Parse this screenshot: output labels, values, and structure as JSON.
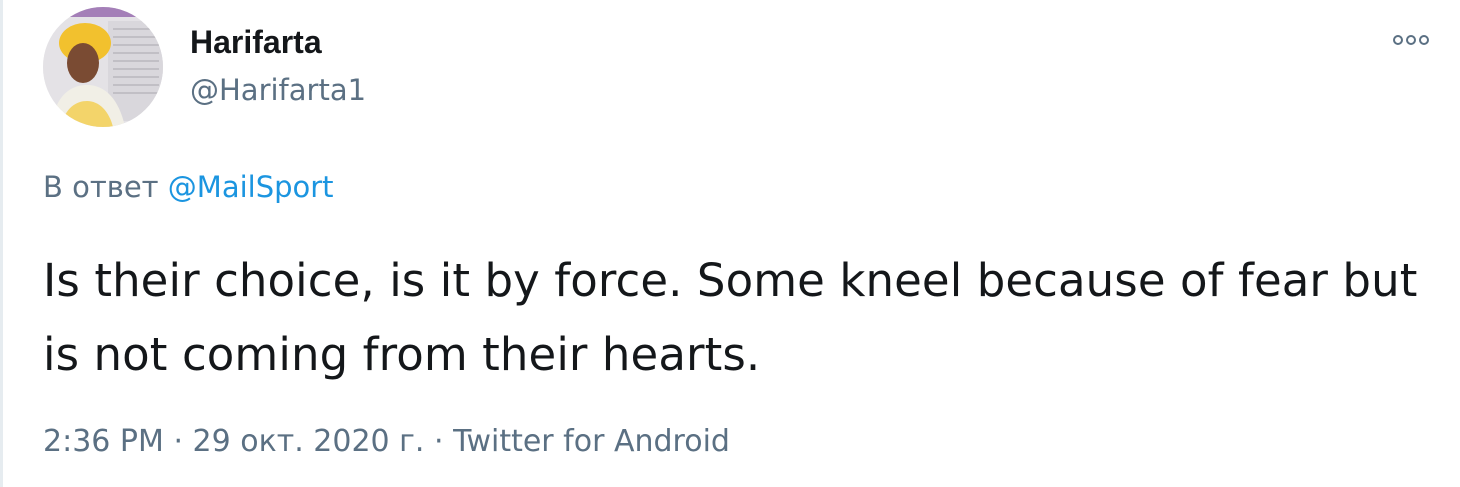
{
  "tweet": {
    "author": {
      "display_name": "Harifarta",
      "handle": "@Harifarta1",
      "avatar": "profile-photo"
    },
    "reply": {
      "prefix": "В ответ",
      "mention": "@MailSport"
    },
    "text": "Is their choice, is it by force. Some kneel because of fear but is not coming from their hearts.",
    "meta": {
      "time": "2:36 PM",
      "separator": "·",
      "date": "29 окт. 2020 г.",
      "source": "Twitter for Android"
    },
    "more_icon": "more-options-icon"
  },
  "colors": {
    "text": "#14171a",
    "secondary": "#5b7083",
    "link": "#1b95e0",
    "border": "#e6ecf0"
  }
}
